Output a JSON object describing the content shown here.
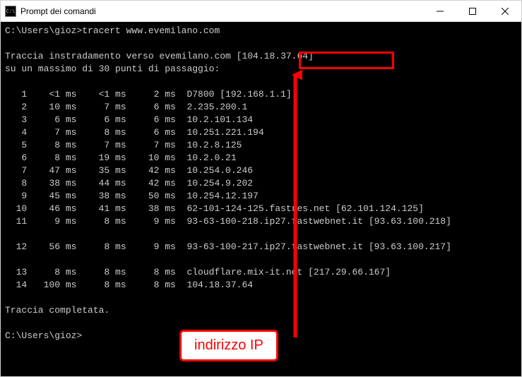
{
  "window": {
    "title": "Prompt dei comandi",
    "icon_text": "C:\\"
  },
  "terminal": {
    "prompt": "C:\\Users\\gioz>",
    "command": "tracert www.evemilano.com",
    "header1": "Traccia instradamento verso evemilano.com [104.18.37.64]",
    "header2": "su un massimo di 30 punti di passaggio:",
    "hops": [
      {
        "n": 1,
        "t1": "<1 ms",
        "t2": "<1 ms",
        "t3": "2 ms",
        "host": "D7800 [192.168.1.1]"
      },
      {
        "n": 2,
        "t1": "10 ms",
        "t2": "7 ms",
        "t3": "6 ms",
        "host": "2.235.200.1"
      },
      {
        "n": 3,
        "t1": "6 ms",
        "t2": "6 ms",
        "t3": "6 ms",
        "host": "10.2.101.134"
      },
      {
        "n": 4,
        "t1": "7 ms",
        "t2": "8 ms",
        "t3": "6 ms",
        "host": "10.251.221.194"
      },
      {
        "n": 5,
        "t1": "8 ms",
        "t2": "7 ms",
        "t3": "7 ms",
        "host": "10.2.8.125"
      },
      {
        "n": 6,
        "t1": "8 ms",
        "t2": "19 ms",
        "t3": "10 ms",
        "host": "10.2.0.21"
      },
      {
        "n": 7,
        "t1": "47 ms",
        "t2": "35 ms",
        "t3": "42 ms",
        "host": "10.254.0.246"
      },
      {
        "n": 8,
        "t1": "38 ms",
        "t2": "44 ms",
        "t3": "42 ms",
        "host": "10.254.9.202"
      },
      {
        "n": 9,
        "t1": "45 ms",
        "t2": "38 ms",
        "t3": "50 ms",
        "host": "10.254.12.197"
      },
      {
        "n": 10,
        "t1": "46 ms",
        "t2": "41 ms",
        "t3": "38 ms",
        "host": "62-101-124-125.fastres.net [62.101.124.125]"
      },
      {
        "n": 11,
        "t1": "9 ms",
        "t2": "8 ms",
        "t3": "9 ms",
        "host": "93-63-100-218.ip27.fastwebnet.it [93.63.100.218]"
      },
      {
        "n": 12,
        "t1": "56 ms",
        "t2": "8 ms",
        "t3": "9 ms",
        "host": "93-63-100-217.ip27.fastwebnet.it [93.63.100.217]"
      },
      {
        "n": 13,
        "t1": "8 ms",
        "t2": "8 ms",
        "t3": "8 ms",
        "host": "cloudflare.mix-it.net [217.29.66.167]"
      },
      {
        "n": 14,
        "t1": "100 ms",
        "t2": "8 ms",
        "t3": "8 ms",
        "host": "104.18.37.64"
      }
    ],
    "footer": "Traccia completata.",
    "prompt2": "C:\\Users\\gioz>"
  },
  "annotation": {
    "label": "indirizzo IP"
  }
}
